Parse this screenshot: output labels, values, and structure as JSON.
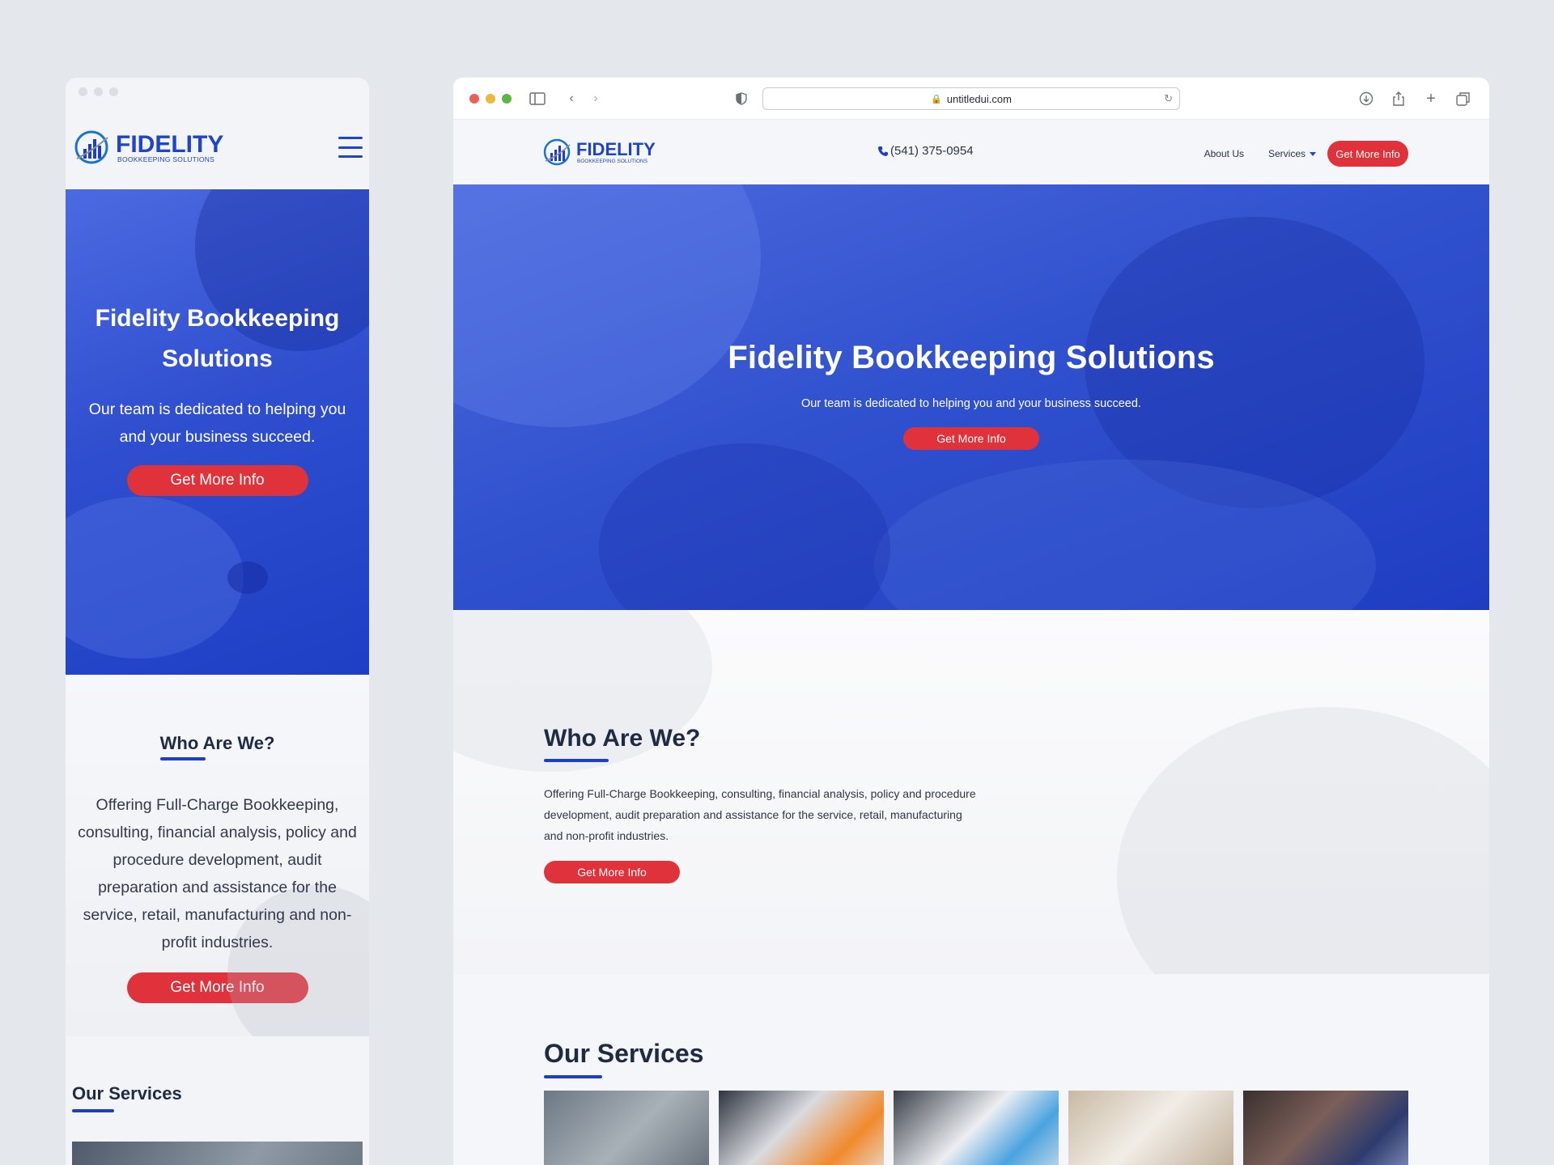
{
  "brand": {
    "name": "FIDELITY",
    "tagline": "BOOKKEEPING SOLUTIONS",
    "primary_color": "#1e3fc4",
    "accent_color": "#e0323a"
  },
  "browser": {
    "url": "untitledui.com"
  },
  "header": {
    "phone": "(541) 375-0954",
    "nav": {
      "about": "About Us",
      "services": "Services",
      "cta": "Get More Info"
    }
  },
  "hero": {
    "title": "Fidelity Bookkeeping Solutions",
    "subtitle": "Our team is dedicated to helping you and your business succeed.",
    "cta": "Get More Info"
  },
  "who": {
    "title": "Who Are We?",
    "text": "Offering Full-Charge Bookkeeping, consulting, financial analysis, policy and procedure development, audit preparation and assistance for the service, retail, manufacturing and non-profit industries.",
    "cta": "Get More Info"
  },
  "services": {
    "title": "Our Services"
  },
  "icons": [
    "menu-icon",
    "phone-icon",
    "lock-icon",
    "reload-icon",
    "sidebar-icon",
    "back-icon",
    "forward-icon",
    "shield-icon",
    "download-icon",
    "share-icon",
    "new-tab-icon",
    "tabs-icon"
  ]
}
